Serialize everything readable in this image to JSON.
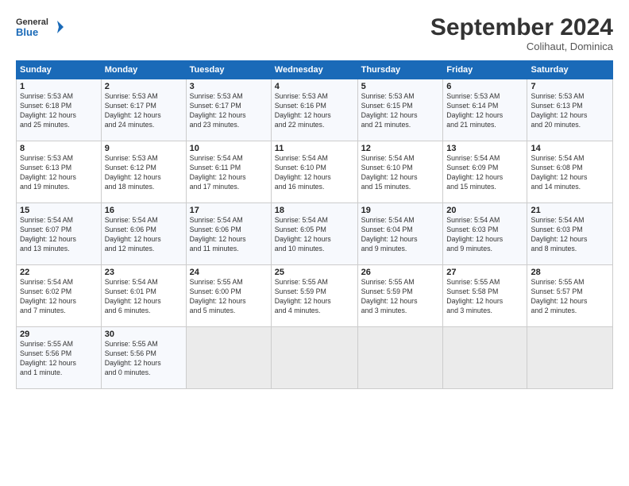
{
  "header": {
    "logo_line1": "General",
    "logo_line2": "Blue",
    "month_title": "September 2024",
    "subtitle": "Colihaut, Dominica"
  },
  "weekdays": [
    "Sunday",
    "Monday",
    "Tuesday",
    "Wednesday",
    "Thursday",
    "Friday",
    "Saturday"
  ],
  "weeks": [
    [
      {
        "day": "1",
        "info": "Sunrise: 5:53 AM\nSunset: 6:18 PM\nDaylight: 12 hours\nand 25 minutes."
      },
      {
        "day": "2",
        "info": "Sunrise: 5:53 AM\nSunset: 6:17 PM\nDaylight: 12 hours\nand 24 minutes."
      },
      {
        "day": "3",
        "info": "Sunrise: 5:53 AM\nSunset: 6:17 PM\nDaylight: 12 hours\nand 23 minutes."
      },
      {
        "day": "4",
        "info": "Sunrise: 5:53 AM\nSunset: 6:16 PM\nDaylight: 12 hours\nand 22 minutes."
      },
      {
        "day": "5",
        "info": "Sunrise: 5:53 AM\nSunset: 6:15 PM\nDaylight: 12 hours\nand 21 minutes."
      },
      {
        "day": "6",
        "info": "Sunrise: 5:53 AM\nSunset: 6:14 PM\nDaylight: 12 hours\nand 21 minutes."
      },
      {
        "day": "7",
        "info": "Sunrise: 5:53 AM\nSunset: 6:13 PM\nDaylight: 12 hours\nand 20 minutes."
      }
    ],
    [
      {
        "day": "8",
        "info": "Sunrise: 5:53 AM\nSunset: 6:13 PM\nDaylight: 12 hours\nand 19 minutes."
      },
      {
        "day": "9",
        "info": "Sunrise: 5:53 AM\nSunset: 6:12 PM\nDaylight: 12 hours\nand 18 minutes."
      },
      {
        "day": "10",
        "info": "Sunrise: 5:54 AM\nSunset: 6:11 PM\nDaylight: 12 hours\nand 17 minutes."
      },
      {
        "day": "11",
        "info": "Sunrise: 5:54 AM\nSunset: 6:10 PM\nDaylight: 12 hours\nand 16 minutes."
      },
      {
        "day": "12",
        "info": "Sunrise: 5:54 AM\nSunset: 6:10 PM\nDaylight: 12 hours\nand 15 minutes."
      },
      {
        "day": "13",
        "info": "Sunrise: 5:54 AM\nSunset: 6:09 PM\nDaylight: 12 hours\nand 15 minutes."
      },
      {
        "day": "14",
        "info": "Sunrise: 5:54 AM\nSunset: 6:08 PM\nDaylight: 12 hours\nand 14 minutes."
      }
    ],
    [
      {
        "day": "15",
        "info": "Sunrise: 5:54 AM\nSunset: 6:07 PM\nDaylight: 12 hours\nand 13 minutes."
      },
      {
        "day": "16",
        "info": "Sunrise: 5:54 AM\nSunset: 6:06 PM\nDaylight: 12 hours\nand 12 minutes."
      },
      {
        "day": "17",
        "info": "Sunrise: 5:54 AM\nSunset: 6:06 PM\nDaylight: 12 hours\nand 11 minutes."
      },
      {
        "day": "18",
        "info": "Sunrise: 5:54 AM\nSunset: 6:05 PM\nDaylight: 12 hours\nand 10 minutes."
      },
      {
        "day": "19",
        "info": "Sunrise: 5:54 AM\nSunset: 6:04 PM\nDaylight: 12 hours\nand 9 minutes."
      },
      {
        "day": "20",
        "info": "Sunrise: 5:54 AM\nSunset: 6:03 PM\nDaylight: 12 hours\nand 9 minutes."
      },
      {
        "day": "21",
        "info": "Sunrise: 5:54 AM\nSunset: 6:03 PM\nDaylight: 12 hours\nand 8 minutes."
      }
    ],
    [
      {
        "day": "22",
        "info": "Sunrise: 5:54 AM\nSunset: 6:02 PM\nDaylight: 12 hours\nand 7 minutes."
      },
      {
        "day": "23",
        "info": "Sunrise: 5:54 AM\nSunset: 6:01 PM\nDaylight: 12 hours\nand 6 minutes."
      },
      {
        "day": "24",
        "info": "Sunrise: 5:55 AM\nSunset: 6:00 PM\nDaylight: 12 hours\nand 5 minutes."
      },
      {
        "day": "25",
        "info": "Sunrise: 5:55 AM\nSunset: 5:59 PM\nDaylight: 12 hours\nand 4 minutes."
      },
      {
        "day": "26",
        "info": "Sunrise: 5:55 AM\nSunset: 5:59 PM\nDaylight: 12 hours\nand 3 minutes."
      },
      {
        "day": "27",
        "info": "Sunrise: 5:55 AM\nSunset: 5:58 PM\nDaylight: 12 hours\nand 3 minutes."
      },
      {
        "day": "28",
        "info": "Sunrise: 5:55 AM\nSunset: 5:57 PM\nDaylight: 12 hours\nand 2 minutes."
      }
    ],
    [
      {
        "day": "29",
        "info": "Sunrise: 5:55 AM\nSunset: 5:56 PM\nDaylight: 12 hours\nand 1 minute."
      },
      {
        "day": "30",
        "info": "Sunrise: 5:55 AM\nSunset: 5:56 PM\nDaylight: 12 hours\nand 0 minutes."
      },
      {
        "day": "",
        "info": ""
      },
      {
        "day": "",
        "info": ""
      },
      {
        "day": "",
        "info": ""
      },
      {
        "day": "",
        "info": ""
      },
      {
        "day": "",
        "info": ""
      }
    ]
  ]
}
